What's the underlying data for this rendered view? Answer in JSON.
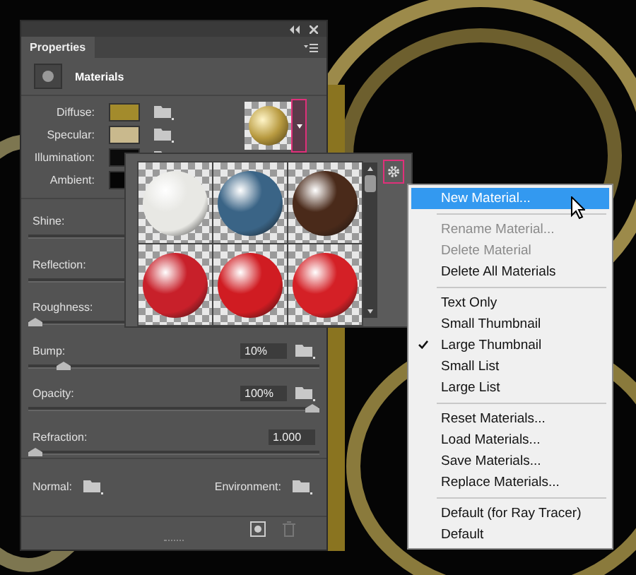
{
  "panel": {
    "tab": "Properties",
    "section": "Materials",
    "swatches": [
      {
        "label": "Diffuse:",
        "color": "#a38b2c"
      },
      {
        "label": "Specular:",
        "color": "#c9b98d"
      },
      {
        "label": "Illumination:",
        "color": "#0b0b0b"
      },
      {
        "label": "Ambient:",
        "color": "#050505"
      }
    ],
    "sliders": [
      {
        "label": "Shine:"
      },
      {
        "label": "Reflection:"
      },
      {
        "label": "Roughness:",
        "level": 0
      },
      {
        "label": "Bump:",
        "value": "10%",
        "level": 0.1,
        "folder": true
      },
      {
        "label": "Opacity:",
        "value": "100%",
        "level": 1,
        "folder": true
      },
      {
        "label": "Refraction:",
        "value": "1.000",
        "level": 0
      }
    ],
    "maps": [
      {
        "label": "Normal:"
      },
      {
        "label": "Environment:"
      }
    ]
  },
  "material_picker": {
    "materials": [
      {
        "color": "#e8e8e4"
      },
      {
        "color": "#3a6486"
      },
      {
        "color": "#4a2a1a"
      },
      {
        "color": "#c8202a"
      },
      {
        "color": "#d01c22"
      },
      {
        "color": "#d42026"
      }
    ]
  },
  "menu": {
    "groups": [
      [
        {
          "label": "New Material...",
          "selected": true,
          "disabled": false,
          "checked": false
        }
      ],
      [
        {
          "label": "Rename Material...",
          "selected": false,
          "disabled": true,
          "checked": false
        },
        {
          "label": "Delete Material",
          "selected": false,
          "disabled": true,
          "checked": false
        },
        {
          "label": "Delete All Materials",
          "selected": false,
          "disabled": false,
          "checked": false
        }
      ],
      [
        {
          "label": "Text Only",
          "selected": false,
          "disabled": false,
          "checked": false
        },
        {
          "label": "Small Thumbnail",
          "selected": false,
          "disabled": false,
          "checked": false
        },
        {
          "label": "Large Thumbnail",
          "selected": false,
          "disabled": false,
          "checked": true
        },
        {
          "label": "Small List",
          "selected": false,
          "disabled": false,
          "checked": false
        },
        {
          "label": "Large List",
          "selected": false,
          "disabled": false,
          "checked": false
        }
      ],
      [
        {
          "label": "Reset Materials...",
          "selected": false,
          "disabled": false,
          "checked": false
        },
        {
          "label": "Load Materials...",
          "selected": false,
          "disabled": false,
          "checked": false
        },
        {
          "label": "Save Materials...",
          "selected": false,
          "disabled": false,
          "checked": false
        },
        {
          "label": "Replace Materials...",
          "selected": false,
          "disabled": false,
          "checked": false
        }
      ],
      [
        {
          "label": "Default (for Ray Tracer)",
          "selected": false,
          "disabled": false,
          "checked": false
        },
        {
          "label": "Default",
          "selected": false,
          "disabled": false,
          "checked": false
        }
      ]
    ]
  }
}
